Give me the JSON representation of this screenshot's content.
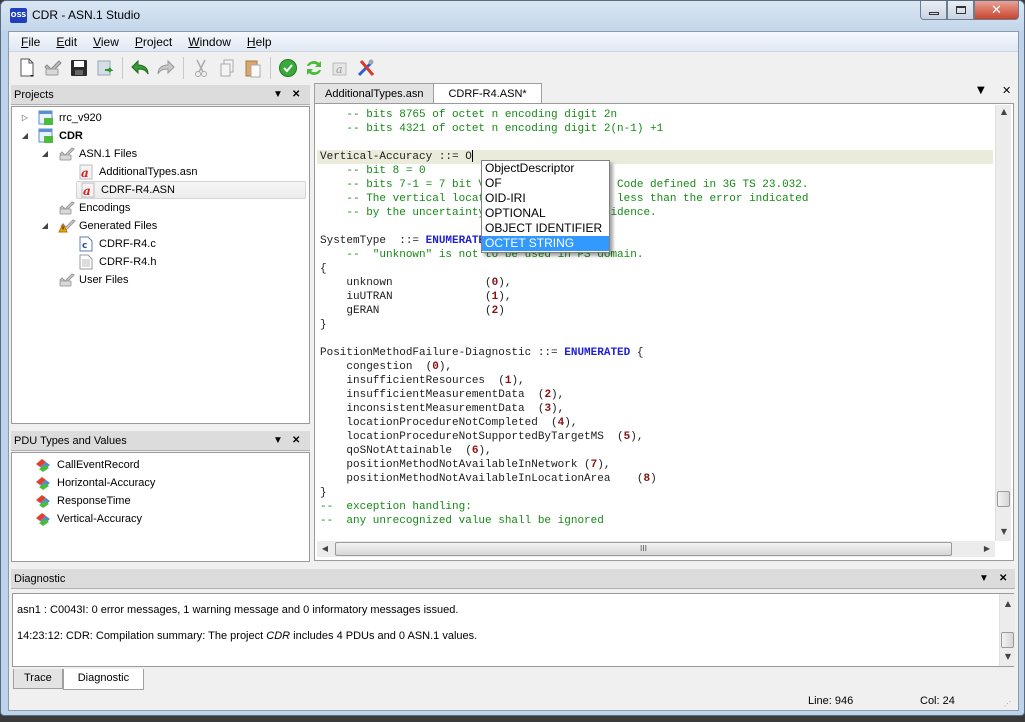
{
  "window": {
    "app_icon": "OSS",
    "title": "CDR - ASN.1 Studio",
    "controls": {
      "minimize": "minimize-icon",
      "maximize": "maximize-icon",
      "close": "close-icon"
    }
  },
  "menu": [
    {
      "label": "File",
      "mnemonic": "F",
      "rest": "ile"
    },
    {
      "label": "Edit",
      "mnemonic": "E",
      "rest": "dit"
    },
    {
      "label": "View",
      "mnemonic": "V",
      "rest": "iew"
    },
    {
      "label": "Project",
      "mnemonic": "P",
      "rest": "roject"
    },
    {
      "label": "Window",
      "mnemonic": "W",
      "rest": "indow"
    },
    {
      "label": "Help",
      "mnemonic": "H",
      "rest": "elp"
    }
  ],
  "toolbar": {
    "buttons": [
      "new-file-icon",
      "open-project-icon",
      "save-icon",
      "save-all-icon",
      "undo-icon",
      "redo-icon",
      "cut-icon",
      "copy-icon",
      "paste-icon",
      "check-syntax-icon",
      "compile-icon",
      "generate-icon",
      "tools-icon"
    ]
  },
  "projects_panel": {
    "title": "Projects",
    "tree": [
      {
        "label": "rrc_v920",
        "level": 0,
        "expanded": false,
        "bold": false,
        "icon": "project-icon"
      },
      {
        "label": "CDR",
        "level": 0,
        "expanded": true,
        "bold": true,
        "icon": "project-icon"
      },
      {
        "label": "ASN.1 Files",
        "level": 1,
        "expanded": true,
        "icon": "folder-icon"
      },
      {
        "label": "AdditionalTypes.asn",
        "level": 2,
        "icon": "asn-file-icon"
      },
      {
        "label": "CDRF-R4.ASN",
        "level": 2,
        "icon": "asn-file-icon",
        "selected": true
      },
      {
        "label": "Encodings",
        "level": 1,
        "icon": "folder-icon"
      },
      {
        "label": "Generated Files",
        "level": 1,
        "expanded": true,
        "icon": "folder-warning-icon"
      },
      {
        "label": "CDRF-R4.c",
        "level": 2,
        "icon": "c-file-icon"
      },
      {
        "label": "CDRF-R4.h",
        "level": 2,
        "icon": "h-file-icon"
      },
      {
        "label": "User Files",
        "level": 1,
        "icon": "folder-icon"
      }
    ]
  },
  "pdu_panel": {
    "title": "PDU Types and Values",
    "items": [
      "CallEventRecord",
      "Horizontal-Accuracy",
      "ResponseTime",
      "Vertical-Accuracy"
    ]
  },
  "editor": {
    "tabs": [
      {
        "label": "AdditionalTypes.asn",
        "active": false
      },
      {
        "label": "CDRF-R4.ASN*",
        "active": true
      }
    ],
    "lines": [
      [
        {
          "t": "    -- bits 8765 of octet n encoding digit 2n",
          "c": "cmt"
        }
      ],
      [
        {
          "t": "    -- bits 4321 of octet n encoding digit 2(n-1) +1",
          "c": "cmt"
        }
      ],
      [],
      [
        {
          "t": "Vertical-Accuracy ::= O",
          "c": "id"
        }
      ],
      [
        {
          "t": "    -- bit 8 = 0",
          "c": "cmt"
        }
      ],
      [
        {
          "t": "    -- bits 7-1 = 7 bit Vertical Uncertainty Code defined in 3G TS 23.032.",
          "c": "cmt"
        }
      ],
      [
        {
          "t": "    -- The vertical location error should be less than the error indicated",
          "c": "cmt"
        }
      ],
      [
        {
          "t": "    -- by the uncertainty code with 67% confidence.",
          "c": "cmt"
        }
      ],
      [],
      [
        {
          "t": "SystemType  ::= ",
          "c": "id"
        },
        {
          "t": "ENUMERATED",
          "c": "kw"
        }
      ],
      [
        {
          "t": "    --  \"unknown\" is not to be used in PS domain.",
          "c": "cmt"
        }
      ],
      [
        {
          "t": "{",
          "c": "id"
        }
      ],
      [
        {
          "t": "    unknown              ",
          "c": "id"
        },
        {
          "t": "(",
          "c": "id"
        },
        {
          "t": "0",
          "c": "num"
        },
        {
          "t": "),",
          "c": "id"
        }
      ],
      [
        {
          "t": "    iuUTRAN              ",
          "c": "id"
        },
        {
          "t": "(",
          "c": "id"
        },
        {
          "t": "1",
          "c": "num"
        },
        {
          "t": "),",
          "c": "id"
        }
      ],
      [
        {
          "t": "    gERAN                ",
          "c": "id"
        },
        {
          "t": "(",
          "c": "id"
        },
        {
          "t": "2",
          "c": "num"
        },
        {
          "t": ")",
          "c": "id"
        }
      ],
      [
        {
          "t": "}",
          "c": "id"
        }
      ],
      [],
      [
        {
          "t": "PositionMethodFailure-Diagnostic ::= ",
          "c": "id"
        },
        {
          "t": "ENUMERATED",
          "c": "kw"
        },
        {
          "t": " {",
          "c": "id"
        }
      ],
      [
        {
          "t": "    congestion  (",
          "c": "id"
        },
        {
          "t": "0",
          "c": "num"
        },
        {
          "t": "),",
          "c": "id"
        }
      ],
      [
        {
          "t": "    insufficientResources  (",
          "c": "id"
        },
        {
          "t": "1",
          "c": "num"
        },
        {
          "t": "),",
          "c": "id"
        }
      ],
      [
        {
          "t": "    insufficientMeasurementData  (",
          "c": "id"
        },
        {
          "t": "2",
          "c": "num"
        },
        {
          "t": "),",
          "c": "id"
        }
      ],
      [
        {
          "t": "    inconsistentMeasurementData  (",
          "c": "id"
        },
        {
          "t": "3",
          "c": "num"
        },
        {
          "t": "),",
          "c": "id"
        }
      ],
      [
        {
          "t": "    locationProcedureNotCompleted  (",
          "c": "id"
        },
        {
          "t": "4",
          "c": "num"
        },
        {
          "t": "),",
          "c": "id"
        }
      ],
      [
        {
          "t": "    locationProcedureNotSupportedByTargetMS  (",
          "c": "id"
        },
        {
          "t": "5",
          "c": "num"
        },
        {
          "t": "),",
          "c": "id"
        }
      ],
      [
        {
          "t": "    qoSNotAttainable  (",
          "c": "id"
        },
        {
          "t": "6",
          "c": "num"
        },
        {
          "t": "),",
          "c": "id"
        }
      ],
      [
        {
          "t": "    positionMethodNotAvailableInNetwork (",
          "c": "id"
        },
        {
          "t": "7",
          "c": "num"
        },
        {
          "t": "),",
          "c": "id"
        }
      ],
      [
        {
          "t": "    positionMethodNotAvailableInLocationArea    (",
          "c": "id"
        },
        {
          "t": "8",
          "c": "num"
        },
        {
          "t": ")",
          "c": "id"
        }
      ],
      [
        {
          "t": "}",
          "c": "id"
        }
      ],
      [
        {
          "t": "--  exception handling:",
          "c": "cmt"
        }
      ],
      [
        {
          "t": "--  any unrecognized value shall be ignored",
          "c": "cmt"
        }
      ]
    ],
    "current_line_index": 3,
    "autocomplete": {
      "items": [
        "ObjectDescriptor",
        "OF",
        "OID-IRI",
        "OPTIONAL",
        "OBJECT IDENTIFIER",
        "OCTET STRING"
      ],
      "selected": "OCTET STRING"
    },
    "hscroll_grip": "III"
  },
  "diagnostic_panel": {
    "title": "Diagnostic",
    "messages": [
      {
        "prefix": "asn1 : C0043I: 0 error messages, 1 warning message and 0 informatory messages issued.",
        "italic": "",
        "suffix": ""
      },
      {
        "prefix": "14:23:12: CDR: Compilation summary: The project ",
        "italic": "CDR",
        "suffix": " includes 4 PDUs and 0 ASN.1 values."
      }
    ],
    "tabs": [
      {
        "label": "Trace",
        "active": false
      },
      {
        "label": "Diagnostic",
        "active": true
      }
    ]
  },
  "status_bar": {
    "line": "Line: 946",
    "col": "Col: 24"
  },
  "colors": {
    "comment": "#158a15",
    "keyword": "#1f1fd4",
    "number": "#8a1010",
    "selection": "#3399ff",
    "current_line": "#ebebdc"
  }
}
